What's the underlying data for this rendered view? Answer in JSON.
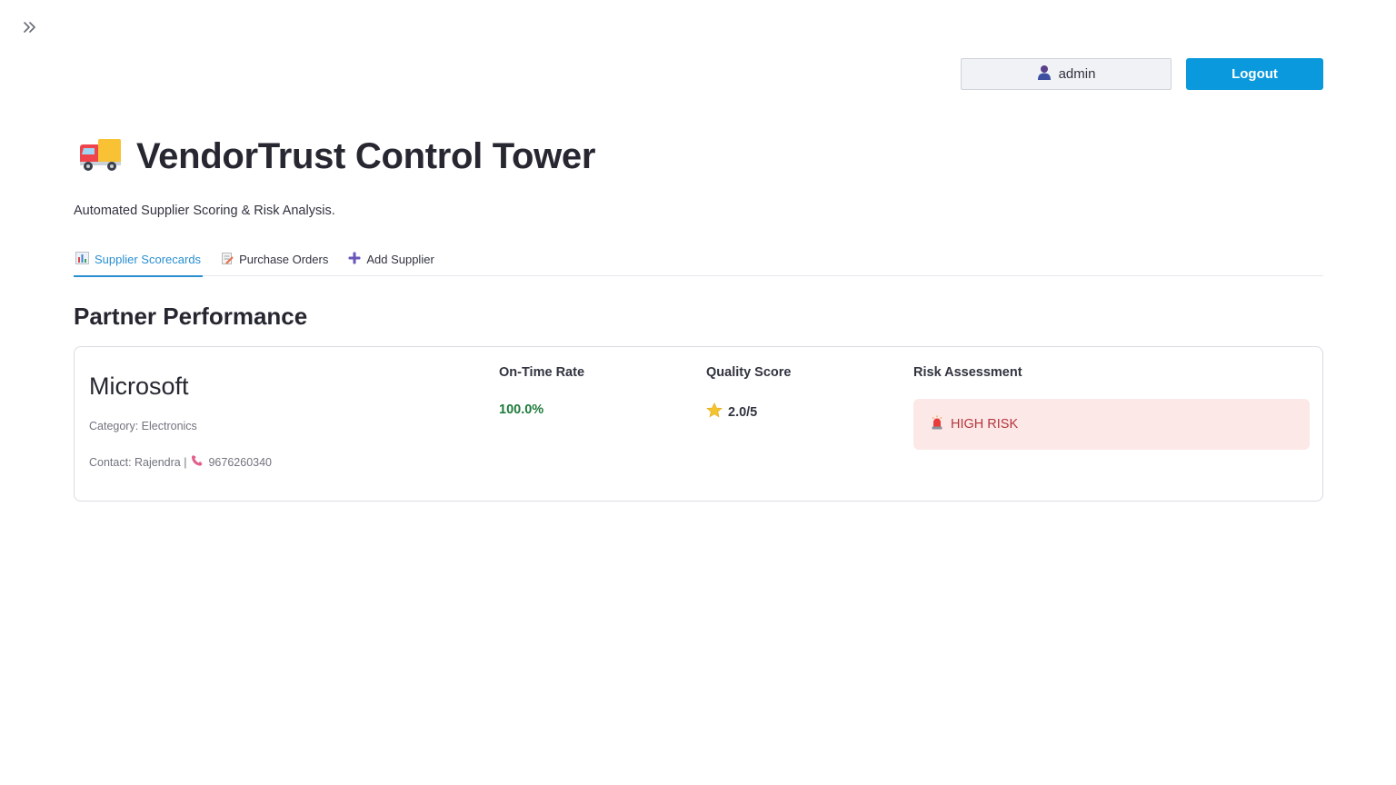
{
  "header": {
    "user_name": "admin",
    "logout_label": "Logout"
  },
  "app": {
    "title": "VendorTrust Control Tower",
    "subtitle": "Automated Supplier Scoring & Risk Analysis."
  },
  "tabs": [
    {
      "label": "Supplier Scorecards",
      "icon": "bar-chart-icon",
      "active": true
    },
    {
      "label": "Purchase Orders",
      "icon": "memo-icon",
      "active": false
    },
    {
      "label": "Add Supplier",
      "icon": "plus-icon",
      "active": false
    }
  ],
  "section": {
    "title": "Partner Performance"
  },
  "supplier": {
    "name": "Microsoft",
    "category": "Category: Electronics",
    "contact": "Contact: Rajendra |",
    "phone": "9676260340",
    "metrics": {
      "on_time_label": "On-Time Rate",
      "on_time_value": "100.0%",
      "quality_label": "Quality Score",
      "quality_value": "2.0/5",
      "risk_label": "Risk Assessment",
      "risk_value": "HIGH RISK"
    }
  },
  "colors": {
    "accent": "#0a99dc",
    "tab_active": "#2a8fd0",
    "positive": "#1e7a3a",
    "risk_bg": "#fde8e8",
    "risk_text": "#b3363a"
  }
}
